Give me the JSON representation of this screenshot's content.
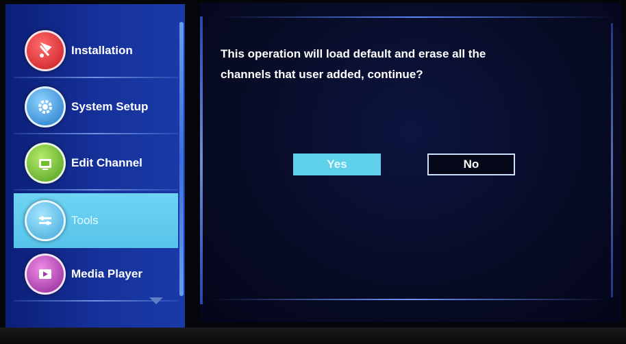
{
  "menu": {
    "items": [
      {
        "label": "Installation",
        "icon": "installation-icon",
        "color": "#d9262a",
        "selected": false
      },
      {
        "label": "System Setup",
        "icon": "gear-icon",
        "color": "#2f8fe0",
        "selected": false
      },
      {
        "label": "Edit Channel",
        "icon": "edit-channel-icon",
        "color": "#6fbf2a",
        "selected": false
      },
      {
        "label": "Tools",
        "icon": "tools-icon",
        "color": "#4fb8e2",
        "selected": true
      },
      {
        "label": "Media Player",
        "icon": "media-player-icon",
        "color": "#a23aa8",
        "selected": false
      }
    ]
  },
  "dialog": {
    "message_line1": "This operation will load default and erase all the",
    "message_line2": "channels that user added, continue?",
    "yes_label": "Yes",
    "no_label": "No",
    "focused": "Yes"
  },
  "colors": {
    "sidebar": "#16329c",
    "selected": "#57c3ea",
    "panel": "#070b24",
    "yes_button": "#5fd0ea"
  }
}
